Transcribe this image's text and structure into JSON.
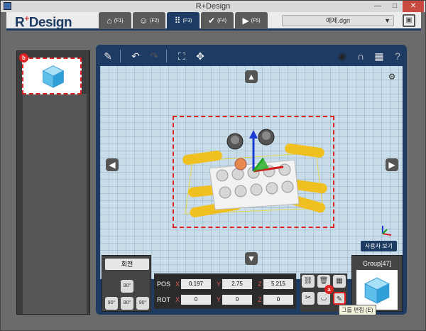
{
  "window": {
    "title": "R+Design"
  },
  "header": {
    "logo": "R+Design",
    "tabs": [
      {
        "label": "(F1)",
        "icon": "home-icon"
      },
      {
        "label": "(F2)",
        "icon": "user-icon"
      },
      {
        "label": "(F3)",
        "icon": "grid-icon",
        "active": true
      },
      {
        "label": "(F4)",
        "icon": "check-icon"
      },
      {
        "label": "(F5)",
        "icon": "play-icon"
      }
    ],
    "file_name": "예제.dgn"
  },
  "sidebar": {
    "badge": "b"
  },
  "viewport": {
    "view_label": "사용자 보기"
  },
  "rotation": {
    "title": "회전",
    "buttons": [
      "90°",
      "90°",
      "90°",
      "90°"
    ]
  },
  "coords": {
    "pos_label": "POS",
    "rot_label": "ROT",
    "pos": {
      "x": "0.197",
      "y": "2.75",
      "z": "5.215"
    },
    "rot": {
      "x": "0",
      "y": "0",
      "z": "0"
    }
  },
  "edit": {
    "badge": "a",
    "tooltip": "그룹 편집 (E)"
  },
  "group": {
    "title": "Group[47]"
  },
  "colors": {
    "accent": "#1e3c63",
    "alert": "#d22222",
    "viewport": "#c8dde9"
  }
}
